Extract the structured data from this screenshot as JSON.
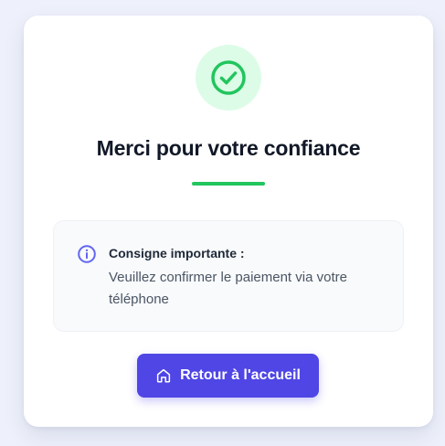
{
  "confirmation": {
    "title": "Merci pour votre confiance",
    "notice": {
      "heading": "Consigne importante :",
      "text": "Veuillez confirmer le paiement via votre téléphone"
    },
    "home_button_label": "Retour à l'accueil"
  },
  "icons": {
    "success": "check-circle-icon",
    "notice": "info-icon",
    "home": "home-icon"
  },
  "colors": {
    "accent": "#4f46e5",
    "success": "#22c55e",
    "success_bg": "#dcfce7",
    "info": "#6366f1"
  }
}
